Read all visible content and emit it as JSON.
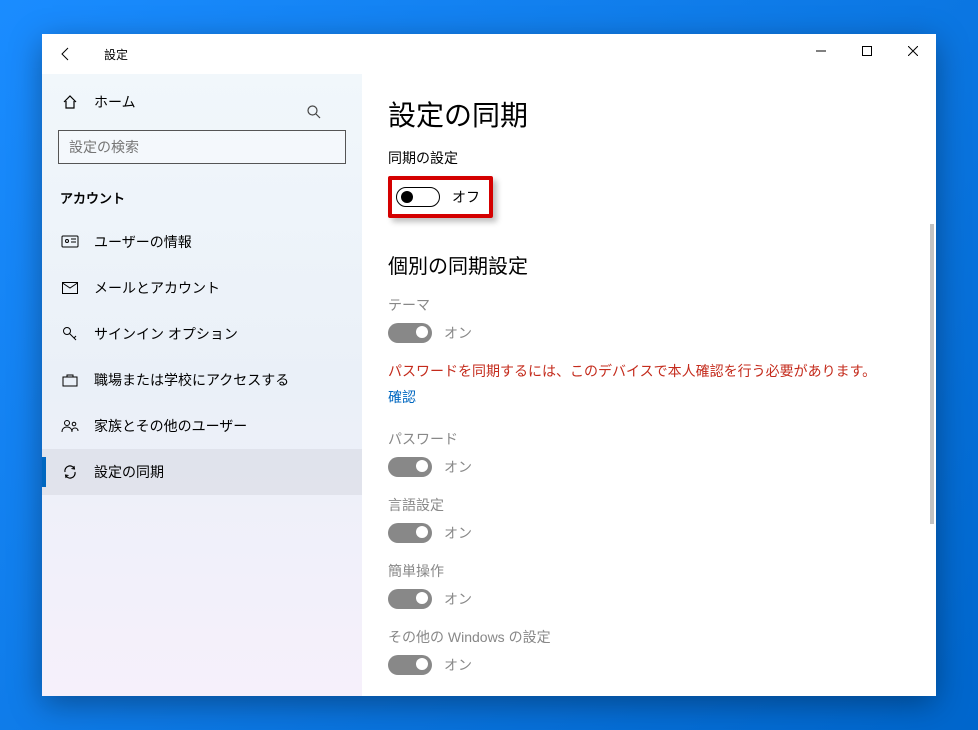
{
  "window": {
    "title": "設定"
  },
  "sidebar": {
    "home": "ホーム",
    "search_placeholder": "設定の検索",
    "section": "アカウント",
    "items": [
      {
        "label": "ユーザーの情報"
      },
      {
        "label": "メールとアカウント"
      },
      {
        "label": "サインイン オプション"
      },
      {
        "label": "職場または学校にアクセスする"
      },
      {
        "label": "家族とその他のユーザー"
      },
      {
        "label": "設定の同期"
      }
    ]
  },
  "main": {
    "title": "設定の同期",
    "sync_settings_label": "同期の設定",
    "sync_master_state": "オフ",
    "individual_heading": "個別の同期設定",
    "warning": "パスワードを同期するには、このデバイスで本人確認を行う必要があります。",
    "verify_link": "確認",
    "settings": [
      {
        "label": "テーマ",
        "state": "オン"
      },
      {
        "label": "パスワード",
        "state": "オン"
      },
      {
        "label": "言語設定",
        "state": "オン"
      },
      {
        "label": "簡単操作",
        "state": "オン"
      },
      {
        "label": "その他の Windows の設定",
        "state": "オン"
      }
    ]
  }
}
